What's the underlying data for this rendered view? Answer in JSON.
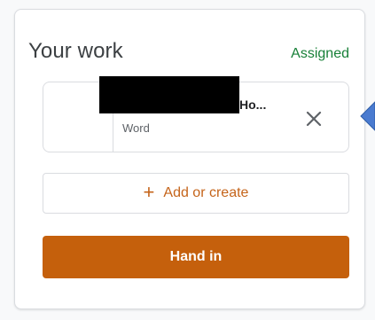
{
  "card": {
    "title": "Your work",
    "status": "Assigned"
  },
  "attachment": {
    "file_name": "Ho...",
    "file_type": "Word",
    "remove_icon": "close-icon"
  },
  "actions": {
    "add_label": "Add or create",
    "add_icon": "plus-icon",
    "hand_in_label": "Hand in"
  },
  "colors": {
    "status": "#188038",
    "accent": "#c5641a",
    "hand_in_bg": "#c5600c",
    "pointer": "#4a7bd0"
  }
}
